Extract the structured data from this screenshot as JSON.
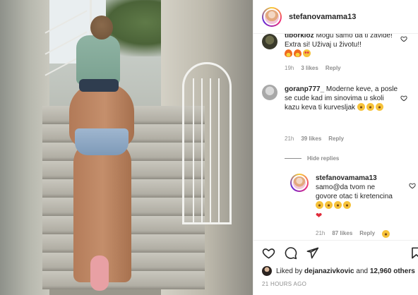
{
  "post": {
    "username": "stefanovamama13"
  },
  "comments": [
    {
      "user": "tiborkloz",
      "text": "Mogu samo da ti zavide! Extra si! Uživaj u životu!!",
      "emojis": [
        "fire",
        "fire",
        "love"
      ],
      "time": "19h",
      "likes": "3 likes",
      "reply": "Reply"
    },
    {
      "user": "goranp777_",
      "text": "Moderne keve, a posle se cude kad im sinovima u skoli kazu keva ti kurvesljak",
      "emojis": [
        "laugh",
        "laugh",
        "laugh"
      ],
      "time": "21h",
      "likes": "39 likes",
      "reply": "Reply"
    }
  ],
  "hide_replies": "Hide replies",
  "reply_comment": {
    "user": "stefanovamama13",
    "text": "samo@da tvom ne govore otac ti kretencina",
    "emojis": [
      "laugh",
      "laugh",
      "laugh",
      "laugh",
      "heart"
    ],
    "time": "21h",
    "likes": "87 likes",
    "reply": "Reply",
    "reply_emoji": "laugh"
  },
  "actions": {
    "liked_by_prefix": "Liked by",
    "liked_by_user": "dejanazivkovic",
    "liked_by_and": "and",
    "liked_by_others": "12,960 others",
    "time_ago": "21 HOURS AGO"
  },
  "colors": {
    "text": "#262626",
    "muted": "#8e8e8e",
    "heart_red": "#e02b3a"
  },
  "icons": [
    "heart-icon",
    "comment-icon",
    "share-icon",
    "bookmark-icon",
    "small-heart-icon"
  ]
}
